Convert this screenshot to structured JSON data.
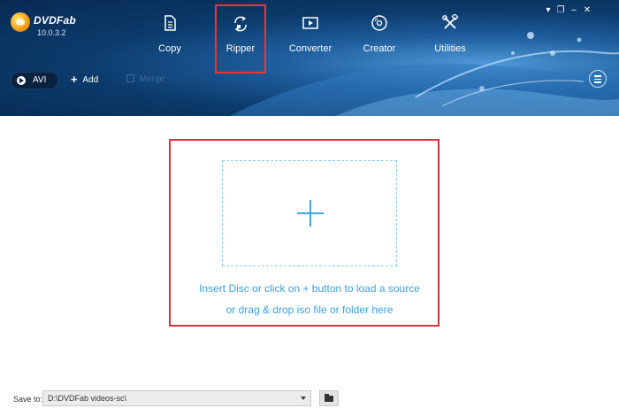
{
  "app": {
    "logo_text": "DVDFab",
    "version": "10.0.3.2",
    "colors": {
      "header_dark": "#072a52",
      "header_light": "#4f9ad8",
      "accent_blue": "#3aa0dc",
      "highlight_red": "#d9343a"
    }
  },
  "window_controls": [
    "▾",
    "❐",
    "–",
    "✕"
  ],
  "nav": {
    "items": [
      {
        "label": "Copy",
        "icon": "document-copy-icon"
      },
      {
        "label": "Ripper",
        "icon": "ripper-arrows-icon",
        "active": true
      },
      {
        "label": "Converter",
        "icon": "film-play-icon"
      },
      {
        "label": "Creator",
        "icon": "disc-icon"
      },
      {
        "label": "Utilities",
        "icon": "tools-icon"
      }
    ]
  },
  "toolbar": {
    "profile_label": "AVI",
    "add_label": "Add",
    "merge_label": "Merge"
  },
  "dropzone": {
    "line1": "Insert Disc or click on + button to load a source",
    "line2": "or drag & drop iso file or folder here"
  },
  "footer": {
    "save_to_label": "Save to:",
    "save_path": "D:\\DVDFab videos-sc\\"
  }
}
